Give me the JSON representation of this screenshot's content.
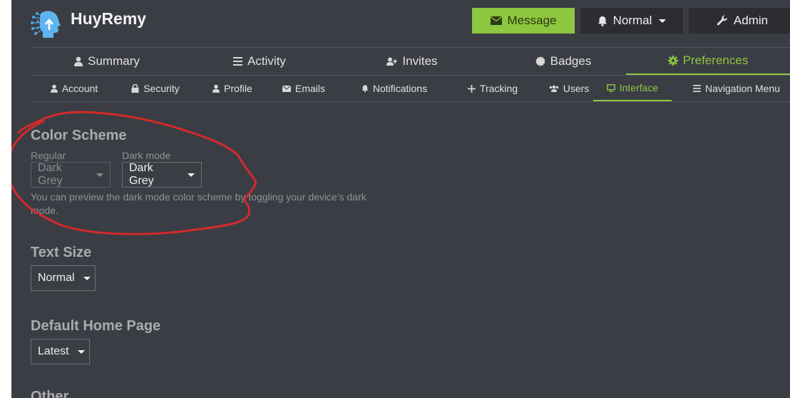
{
  "header": {
    "username": "HuyRemy",
    "message_label": "Message",
    "notification_level": "Normal",
    "admin_label": "Admin"
  },
  "main_nav": [
    {
      "label": "Summary",
      "icon": "user-icon"
    },
    {
      "label": "Activity",
      "icon": "list-icon"
    },
    {
      "label": "Invites",
      "icon": "user-plus-icon"
    },
    {
      "label": "Badges",
      "icon": "certificate-icon"
    },
    {
      "label": "Preferences",
      "icon": "cog-icon",
      "active": true
    }
  ],
  "sub_nav": [
    {
      "label": "Account",
      "icon": "user-icon"
    },
    {
      "label": "Security",
      "icon": "lock-icon"
    },
    {
      "label": "Profile",
      "icon": "user-icon"
    },
    {
      "label": "Emails",
      "icon": "envelope-icon"
    },
    {
      "label": "Notifications",
      "icon": "bell-icon"
    },
    {
      "label": "Tracking",
      "icon": "plus-icon"
    },
    {
      "label": "Users",
      "icon": "users-icon"
    },
    {
      "label": "Interface",
      "icon": "desktop-icon",
      "active": true
    },
    {
      "label": "Navigation Menu",
      "icon": "bars-icon"
    }
  ],
  "color_scheme": {
    "title": "Color Scheme",
    "regular_label": "Regular",
    "regular_value": "Dark Grey",
    "dark_label": "Dark mode",
    "dark_value": "Dark Grey",
    "help": "You can preview the dark mode color scheme by toggling your device's dark mode."
  },
  "text_size": {
    "title": "Text Size",
    "value": "Normal"
  },
  "home_page": {
    "title": "Default Home Page",
    "value": "Latest"
  },
  "other": {
    "title": "Other"
  },
  "colors": {
    "accent": "#8dc63f",
    "background": "#3b3d45",
    "annotation": "#d42a2a"
  }
}
